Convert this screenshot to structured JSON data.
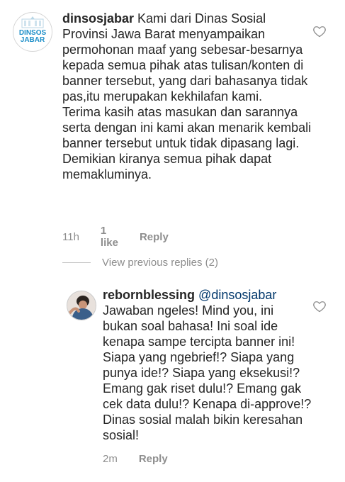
{
  "comment": {
    "username": "dinsosjabar",
    "avatar_text_line1": "DINSOS",
    "avatar_text_line2": "JABAR",
    "text": " Kami dari Dinas Sosial Provinsi Jawa Barat menyampaikan permohonan maaf yang sebesar-besarnya kepada semua pihak atas tulisan/konten di banner tersebut, yang dari bahasanya tidak pas,itu merupakan kekhilafan kami.\nTerima kasih atas masukan dan sarannya serta dengan ini kami akan menarik kembali banner tersebut untuk tidak dipasang lagi.\nDemikian kiranya semua pihak dapat memakluminya.",
    "time": "11h",
    "likes": "1 like",
    "reply_label": "Reply",
    "like_icon": "heart-outline-icon"
  },
  "view_previous_replies": "View previous replies (2)",
  "reply": {
    "username": "rebornblessing",
    "mention": "@dinsosjabar",
    "text": "Jawaban ngeles! Mind you, ini bukan soal bahasa! Ini soal ide kenapa sampe tercipta banner ini! Siapa yang ngebrief!? Siapa yang punya ide!? Siapa yang eksekusi!? Emang gak riset dulu!? Emang gak cek data dulu!? Kenapa di-approve!? Dinas sosial malah bikin keresahan sosial!",
    "time": "2m",
    "reply_label": "Reply",
    "like_icon": "heart-outline-icon"
  },
  "colors": {
    "text": "#262626",
    "secondary": "#8e8e8e",
    "mention": "#00376b",
    "logo_blue": "#1b8ec8"
  }
}
